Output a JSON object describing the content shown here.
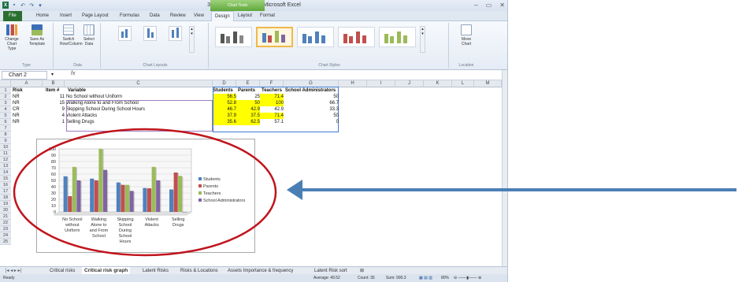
{
  "window": {
    "title": "360 Output for report - Microsoft Excel",
    "chart_tools_label": "Chart Tools",
    "controls": [
      "–",
      "▭",
      "✕"
    ]
  },
  "ribbon_tabs": [
    "File",
    "Home",
    "Insert",
    "Page Layout",
    "Formulas",
    "Data",
    "Review",
    "View",
    "Design",
    "Layout",
    "Format"
  ],
  "ribbon": {
    "type_group": {
      "change_type": "Change Chart Type",
      "save_template": "Save As Template",
      "label": "Type"
    },
    "data_group": {
      "switch": "Switch Row/Column",
      "select": "Select Data",
      "label": "Data"
    },
    "layouts_label": "Chart Layouts",
    "styles_label": "Chart Styles",
    "location_group": {
      "move": "Move Chart",
      "label": "Location"
    }
  },
  "name_box": "Chart 2",
  "formula_fx": "fx",
  "columns": [
    "A",
    "B",
    "C",
    "D",
    "E",
    "F",
    "G",
    "H",
    "I",
    "J",
    "K",
    "L",
    "M"
  ],
  "rows": [
    "1",
    "2",
    "3",
    "4",
    "5",
    "6",
    "7",
    "8",
    "9",
    "10",
    "11",
    "12",
    "13",
    "14",
    "15",
    "16",
    "17",
    "18",
    "19",
    "20",
    "21",
    "22",
    "23",
    "24",
    "25"
  ],
  "table": {
    "headers": {
      "risk": "Risk",
      "item": "Item #",
      "variable": "Variable",
      "students": "Students",
      "parents": "Parents",
      "teachers": "Teachers",
      "admins": "School Administrators"
    },
    "rows": [
      {
        "risk": "NR",
        "item": "11",
        "variable": "No School without Uniform",
        "students": "56.5",
        "parents": "25",
        "teachers": "71.4",
        "admins": "50"
      },
      {
        "risk": "NR",
        "item": "15",
        "variable": "Walking Alone to and From School",
        "students": "52.8",
        "parents": "50",
        "teachers": "100",
        "admins": "66.7"
      },
      {
        "risk": "CR",
        "item": "9",
        "variable": "Skipping School During School Hours",
        "students": "46.7",
        "parents": "42.9",
        "teachers": "42.9",
        "admins": "33.3"
      },
      {
        "risk": "NR",
        "item": "4",
        "variable": "Violent Attacks",
        "students": "37.9",
        "parents": "37.5",
        "teachers": "71.4",
        "admins": "50"
      },
      {
        "risk": "NR",
        "item": "1",
        "variable": "Selling Drugs",
        "students": "35.6",
        "parents": "62.5",
        "teachers": "57.1",
        "admins": "0"
      }
    ]
  },
  "chart_data": {
    "type": "bar",
    "categories": [
      "No School without Uniform",
      "Walking Alone to and From School",
      "Skipping School During School Hours",
      "Violent Attacks",
      "Selling Drugs"
    ],
    "category_lines": [
      [
        "No School",
        "without",
        "Uniform"
      ],
      [
        "Walking",
        "Alone to",
        "and From",
        "School"
      ],
      [
        "Skipping",
        "School",
        "During",
        "School",
        "Hours"
      ],
      [
        "Violent",
        "Attacks"
      ],
      [
        "Selling",
        "Drugs"
      ]
    ],
    "series": [
      {
        "name": "Students",
        "values": [
          56.5,
          52.8,
          46.7,
          37.9,
          35.6
        ],
        "color": "#4f81bd"
      },
      {
        "name": "Parents",
        "values": [
          25,
          50,
          42.9,
          37.5,
          62.5
        ],
        "color": "#c0504d"
      },
      {
        "name": "Teachers",
        "values": [
          71.4,
          100,
          42.9,
          71.4,
          57.1
        ],
        "color": "#9bbb59"
      },
      {
        "name": "School Administrators",
        "values": [
          50,
          66.7,
          33.3,
          50,
          0
        ],
        "color": "#8064a2"
      }
    ],
    "yticks": [
      "0",
      "10",
      "20",
      "30",
      "40",
      "50",
      "60",
      "70",
      "80",
      "90",
      "100"
    ],
    "ylim": [
      0,
      100
    ],
    "grid": true,
    "legend": "right"
  },
  "sheet_tabs": [
    "Critical risks",
    "Critical risk graph",
    "Latent Risks",
    "Risks & Locations",
    "Assets Importance & frequency",
    "Latent Risk sort"
  ],
  "active_sheet": "Critical risk graph",
  "status": {
    "ready": "Ready",
    "average": "Average: 49.52",
    "count": "Count: 35",
    "sum": "Sum: 990.3",
    "zoom": "80%"
  },
  "colors": {
    "highlight": "#ffff00",
    "ellipse": "#c0141c",
    "arrow": "#4a7fb5"
  }
}
